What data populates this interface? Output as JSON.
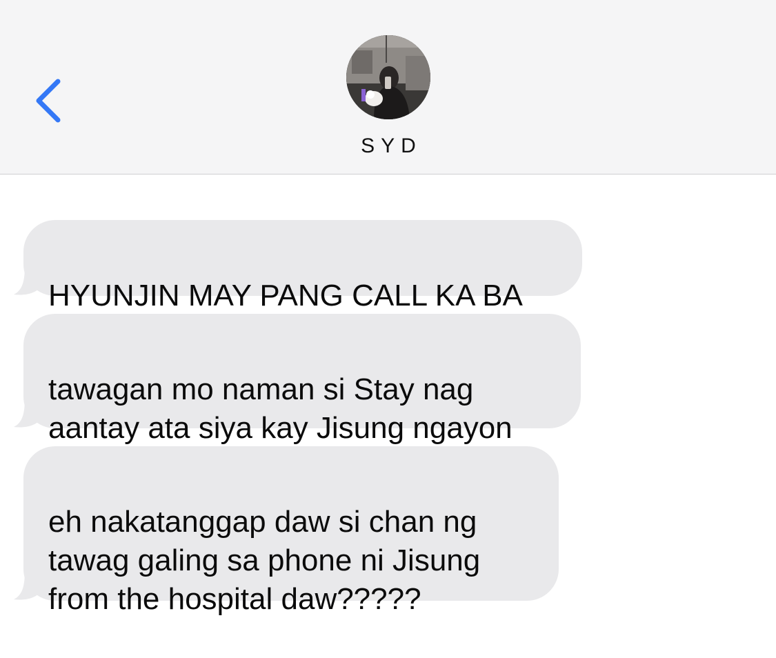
{
  "header": {
    "back_icon": "chevron-left-icon",
    "contact_name": "SYD",
    "avatar_icon": "contact-photo",
    "accent_color": "#3478f6"
  },
  "messages": [
    {
      "direction": "incoming",
      "text": "HYUNJIN MAY PANG CALL KA BA"
    },
    {
      "direction": "incoming",
      "text": "tawagan mo naman si Stay nag\naantay ata siya kay Jisung ngayon"
    },
    {
      "direction": "incoming",
      "text": "eh nakatanggap daw si chan ng\ntawag galing sa phone ni Jisung\nfrom the hospital daw?????"
    }
  ],
  "colors": {
    "header_bg": "#f5f5f6",
    "incoming_bubble": "#e9e9eb",
    "text": "#0b0b0b"
  }
}
